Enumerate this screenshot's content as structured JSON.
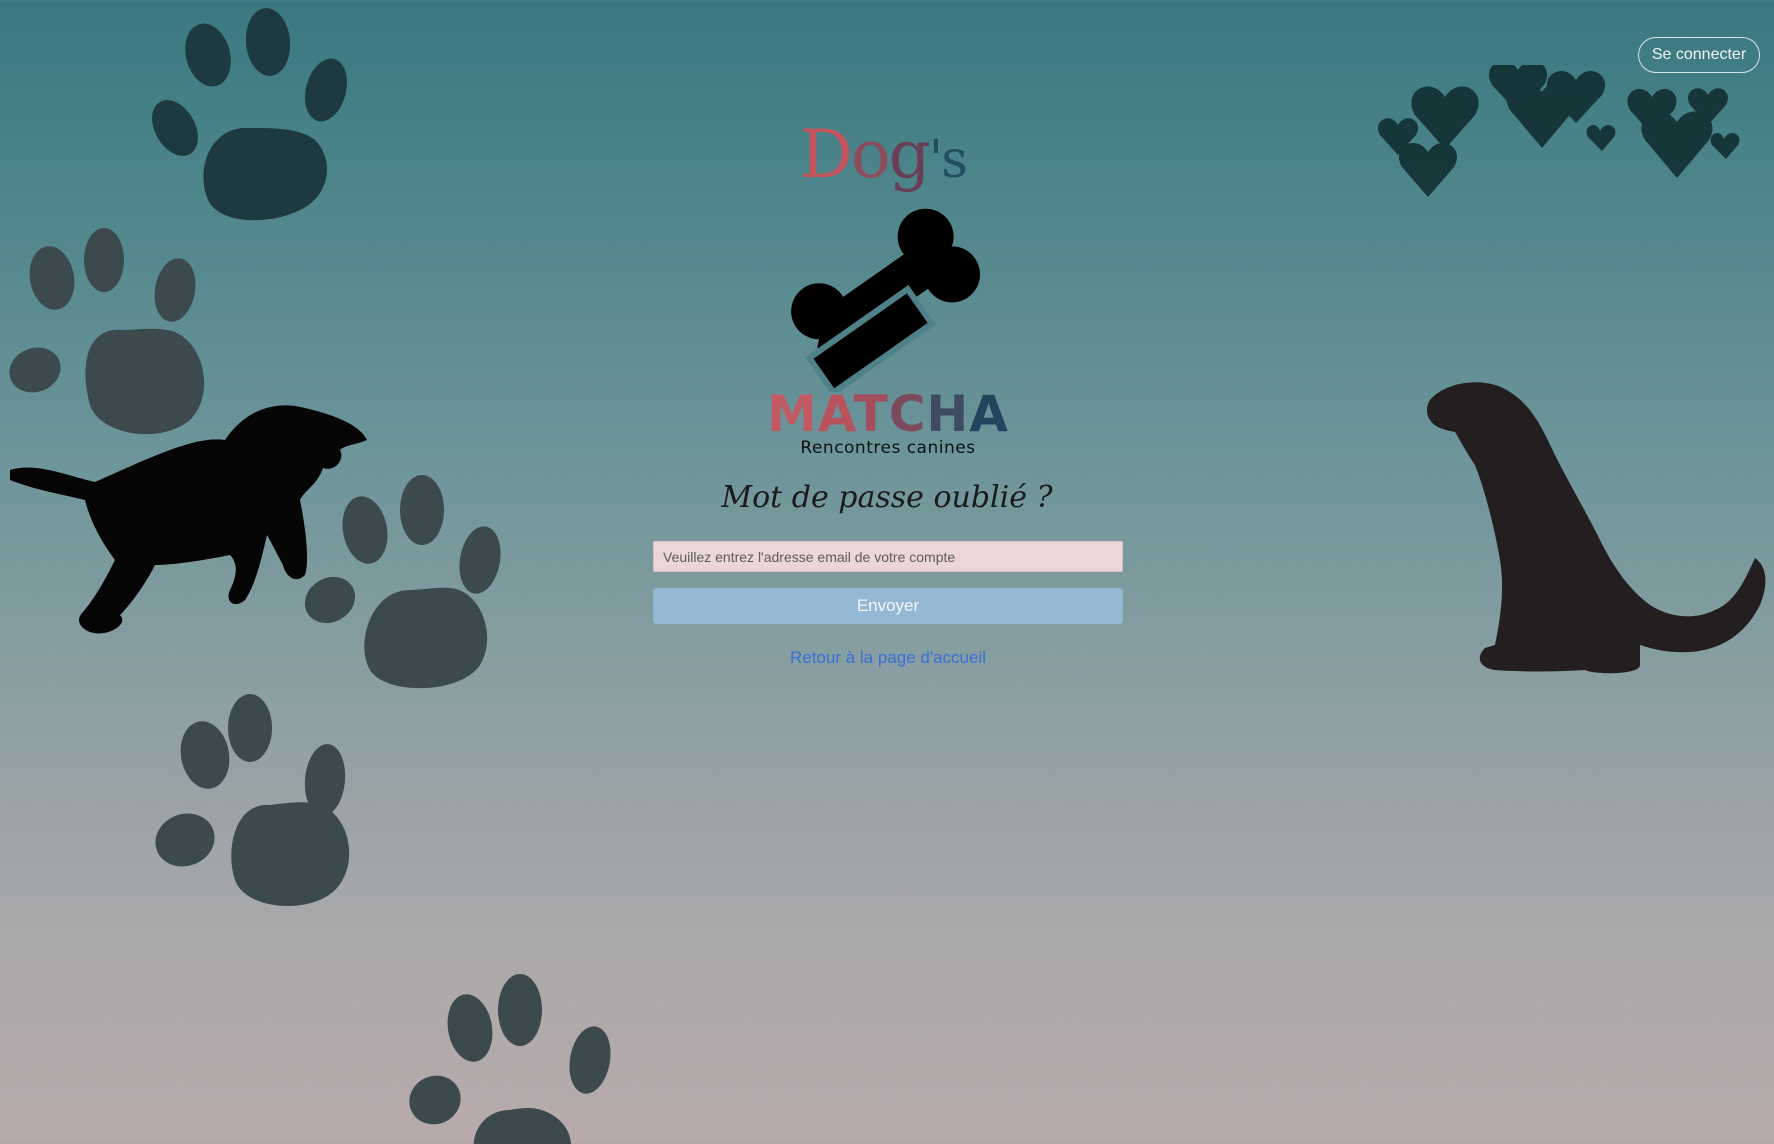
{
  "header": {
    "login_label": "Se connecter"
  },
  "brand": {
    "dogs_d": "D",
    "dogs_o": "o",
    "dogs_g": "g",
    "dogs_s": "'s",
    "matcha_letters": [
      "M",
      "A",
      "T",
      "C",
      "H",
      "A"
    ],
    "tagline": "Rencontres canines"
  },
  "form": {
    "title": "Mot de passe oublié ?",
    "email_placeholder": "Veuillez entrez l'adresse email de votre compte",
    "email_value": "",
    "submit_label": "Envoyer",
    "back_link": "Retour à la page d'accueil"
  },
  "colors": {
    "accent_link": "#3a6fd8",
    "submit_bg": "#94b8d4",
    "input_bg": "#ecd6d9"
  }
}
